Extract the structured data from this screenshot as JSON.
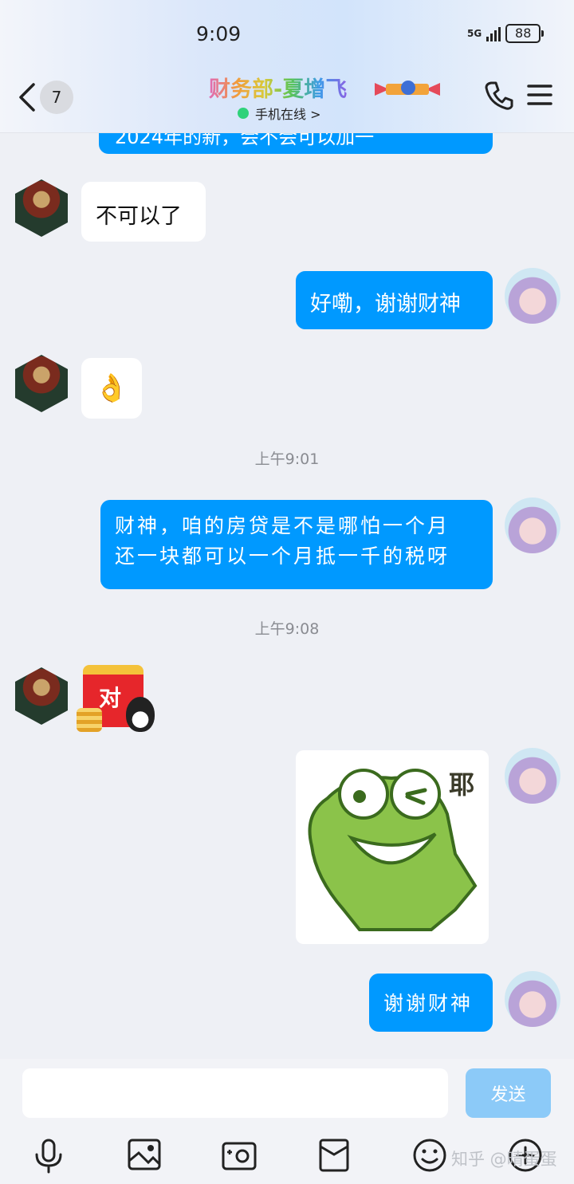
{
  "status_bar": {
    "time": "9:09",
    "network": "5G",
    "battery": "88"
  },
  "header": {
    "back_count": "7",
    "title": "财务部-夏增飞",
    "online_status": "手机在线 >"
  },
  "messages": {
    "partial_top": "2024年的新，会不会可以加一",
    "m1": "不可以了",
    "m2": "好嘞，谢谢财神",
    "m3_emoji": "👌",
    "ts1": "上午9:01",
    "m4_line1": "财神，咱的房贷是不是哪怕一个月",
    "m4_line2": "还一块都可以一个月抵一千的税呀",
    "ts2": "上午9:08",
    "sticker_hongbao": "对",
    "sticker_frog": "耶",
    "m6": "谢谢财神"
  },
  "composer": {
    "send": "发送",
    "input_value": ""
  },
  "watermark": "知乎 @晴蛋蛋",
  "colors": {
    "out_bubble": "#0099ff",
    "in_bubble": "#ffffff",
    "send_disabled": "#8ccaf8"
  }
}
